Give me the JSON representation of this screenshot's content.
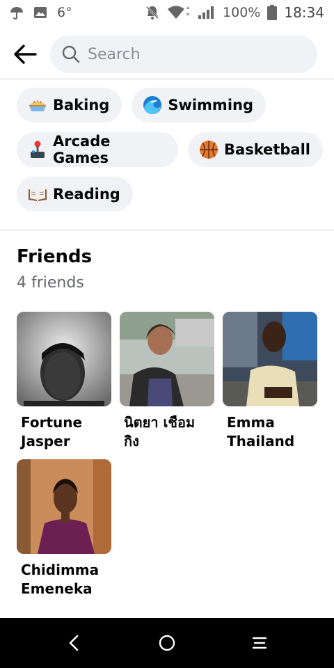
{
  "status_bar": {
    "temperature": "6°",
    "battery": "100%",
    "time": "18:34",
    "icons": [
      "umbrella-icon",
      "gallery-icon",
      "notifications-off-icon",
      "wifi-icon",
      "signal-icon",
      "battery-icon"
    ]
  },
  "header": {
    "search_placeholder": "Search"
  },
  "interests": [
    {
      "label": "Baking",
      "icon": "pie-emoji-icon"
    },
    {
      "label": "Swimming",
      "icon": "wave-emoji-icon"
    },
    {
      "label": "Arcade Games",
      "icon": "joystick-emoji-icon"
    },
    {
      "label": "Basketball",
      "icon": "basketball-emoji-icon"
    },
    {
      "label": "Reading",
      "icon": "open-book-emoji-icon"
    }
  ],
  "friends": {
    "title": "Friends",
    "count": "4 friends",
    "items": [
      {
        "first": "Fortune",
        "last": "Jasper"
      },
      {
        "first": "นิตยา เชือม",
        "last": "กิง"
      },
      {
        "first": "Emma",
        "last": "Thailand"
      },
      {
        "first": "Chidimma",
        "last": "Emeneka"
      }
    ]
  },
  "nav_bar": {
    "icons": [
      "back-icon",
      "home-icon",
      "recents-icon"
    ]
  }
}
